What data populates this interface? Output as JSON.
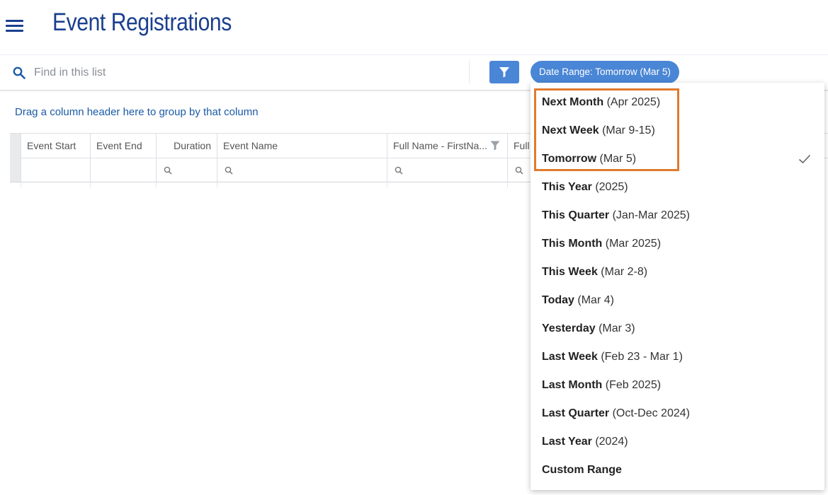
{
  "header": {
    "title": "Event Registrations"
  },
  "search": {
    "placeholder": "Find in this list"
  },
  "toolbar": {
    "date_range_label": "Date Range: Tomorrow (Mar 5)"
  },
  "grid": {
    "group_hint": "Drag a column header here to group by that column",
    "columns": [
      "Event Start",
      "Event End",
      "Duration",
      "Event Name",
      "Full Name - FirstNa...",
      "Full"
    ]
  },
  "dropdown": {
    "selected": "Tomorrow",
    "items": [
      {
        "label": "Next Month",
        "detail": "(Apr 2025)"
      },
      {
        "label": "Next Week",
        "detail": "(Mar 9-15)"
      },
      {
        "label": "Tomorrow",
        "detail": "(Mar 5)"
      },
      {
        "label": "This Year",
        "detail": "(2025)"
      },
      {
        "label": "This Quarter",
        "detail": "(Jan-Mar 2025)"
      },
      {
        "label": "This Month",
        "detail": "(Mar 2025)"
      },
      {
        "label": "This Week",
        "detail": "(Mar 2-8)"
      },
      {
        "label": "Today",
        "detail": "(Mar 4)"
      },
      {
        "label": "Yesterday",
        "detail": "(Mar 3)"
      },
      {
        "label": "Last Week",
        "detail": "(Feb 23 - Mar 1)"
      },
      {
        "label": "Last Month",
        "detail": "(Feb 2025)"
      },
      {
        "label": "Last Quarter",
        "detail": "(Oct-Dec 2024)"
      },
      {
        "label": "Last Year",
        "detail": "(2024)"
      },
      {
        "label": "Custom Range",
        "detail": ""
      }
    ]
  },
  "colors": {
    "accent": "#4a86d6",
    "title": "#1a3f8f",
    "highlight": "#e07a2e"
  }
}
